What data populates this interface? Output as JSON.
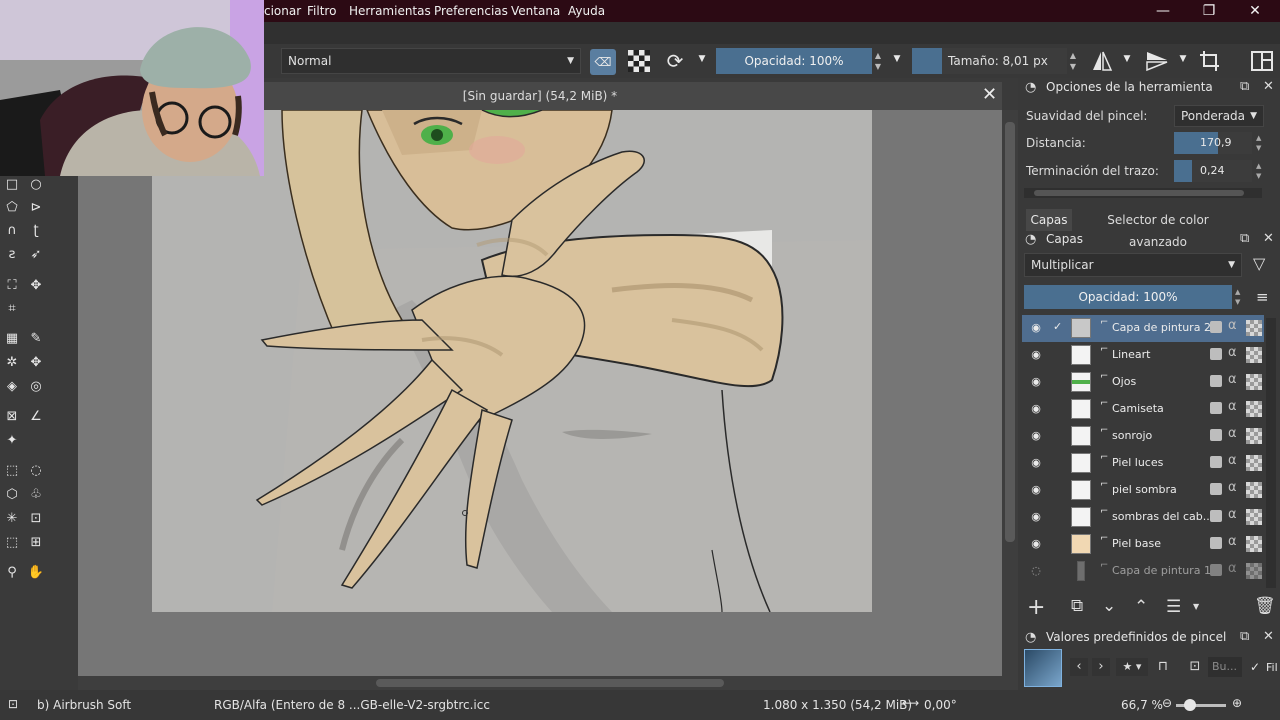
{
  "menu": {
    "items": [
      "cionar",
      "Filtro",
      "Herramientas",
      "Preferencias",
      "Ventana",
      "Ayuda"
    ]
  },
  "window_controls": {
    "minimize": "—",
    "maximize": "❐",
    "close": "✕"
  },
  "tool_options": {
    "blend_mode": "Normal",
    "opacity": "Opacidad: 100%",
    "size": "Tamaño: 8,01 px"
  },
  "document": {
    "title": "[Sin guardar]  (54,2 MiB) *"
  },
  "tool_options_docker": {
    "title": "Opciones de la herramienta",
    "smoothing_label": "Suavidad del pincel:",
    "smoothing_value": "Ponderada",
    "distance_label": "Distancia:",
    "distance_value": "170,9",
    "stroke_end_label": "Terminación del trazo:",
    "stroke_end_value": "0,24"
  },
  "tabs": [
    "Capas",
    "Selector de color avanzado"
  ],
  "layers_docker": {
    "title": "Capas",
    "blend_mode": "Multiplicar",
    "opacity": "Opacidad:  100%",
    "layers": [
      {
        "name": "Capa de pintura 2",
        "active": true
      },
      {
        "name": "Lineart",
        "active": false
      },
      {
        "name": "Ojos",
        "active": false
      },
      {
        "name": "Camiseta",
        "active": false
      },
      {
        "name": "sonrojo",
        "active": false
      },
      {
        "name": "Piel luces",
        "active": false
      },
      {
        "name": "piel sombra",
        "active": false
      },
      {
        "name": "sombras del cab...",
        "active": false
      },
      {
        "name": "Piel base",
        "active": false
      },
      {
        "name": "Capa de pintura 1",
        "active": false
      }
    ]
  },
  "brush_presets_docker": {
    "title": "Valores predefinidos de pincel",
    "search_placeholder": "Bu...",
    "filter_label": "Fil"
  },
  "status": {
    "brush": "b) Airbrush Soft",
    "color_profile": "RGB/Alfa (Entero de 8 ...GB-elle-V2-srgbtrc.icc",
    "dimensions": "1.080 x 1.350 (54,2 MiB)",
    "rotation": "0,00°",
    "zoom": "66,7 %"
  },
  "colors": {
    "menubar_bg": "#2c0a14",
    "accent": "#4a6f90",
    "skin": "#d9c29d",
    "canvas_bg": "#b4b4b2"
  }
}
